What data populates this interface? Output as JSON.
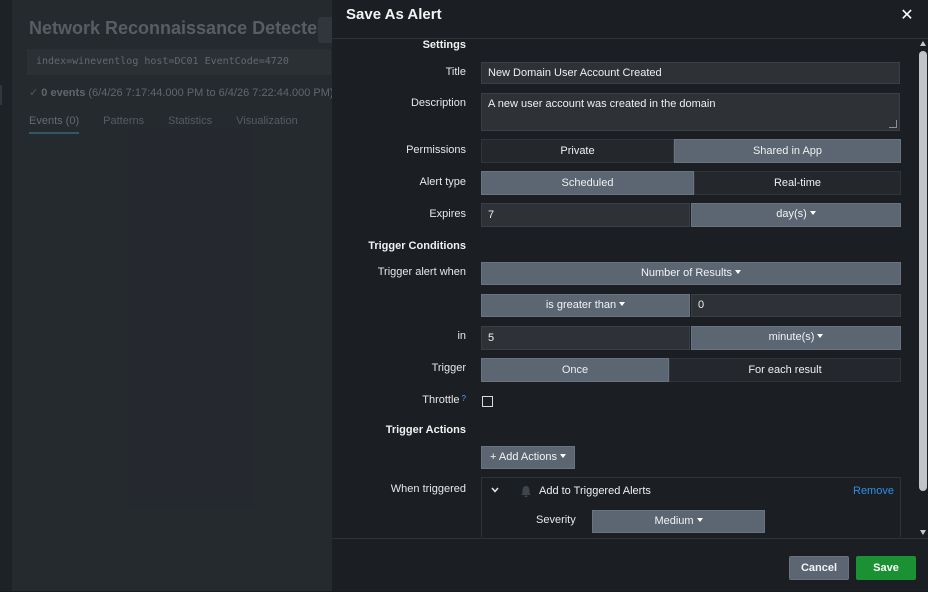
{
  "background": {
    "title": "Network Reconnaissance Detected",
    "query": "index=wineventlog host=DC01 EventCode=4720",
    "events_count": "0 events",
    "events_range": "(6/4/26 7:17:44.000 PM to 6/4/26 7:22:44.000 PM)",
    "tabs": [
      "Events (0)",
      "Patterns",
      "Statistics",
      "Visualization"
    ]
  },
  "modal": {
    "title": "Save As Alert",
    "sections": {
      "settings": "Settings",
      "trigger_conditions": "Trigger Conditions",
      "trigger_actions": "Trigger Actions"
    },
    "labels": {
      "title": "Title",
      "description": "Description",
      "permissions": "Permissions",
      "alert_type": "Alert type",
      "expires": "Expires",
      "trigger_alert_when": "Trigger alert when",
      "in": "in",
      "trigger": "Trigger",
      "throttle": "Throttle",
      "throttle_help": "?",
      "when_triggered": "When triggered",
      "severity": "Severity"
    },
    "values": {
      "title": "New Domain User Account Created",
      "description": "A new user account was created in the domain",
      "expires_value": "7",
      "expires_unit": "day(s)",
      "trigger_condition": "Number of Results",
      "comparison": "is greater than",
      "comparison_value": "0",
      "in_value": "5",
      "in_unit": "minute(s)",
      "severity": "Medium"
    },
    "permissions_options": [
      "Private",
      "Shared in App"
    ],
    "permissions_selected": "Shared in App",
    "alert_type_options": [
      "Scheduled",
      "Real-time"
    ],
    "alert_type_selected": "Scheduled",
    "trigger_options": [
      "Once",
      "For each result"
    ],
    "trigger_selected": "Once",
    "throttle_checked": false,
    "add_actions_label": "+ Add Actions",
    "action": {
      "name": "Add to Triggered Alerts",
      "remove_label": "Remove"
    },
    "buttons": {
      "cancel": "Cancel",
      "save": "Save"
    }
  },
  "colors": {
    "accent_link": "#2d8fe6",
    "save_green": "#1a9234",
    "selected_segment": "#5c6672"
  }
}
